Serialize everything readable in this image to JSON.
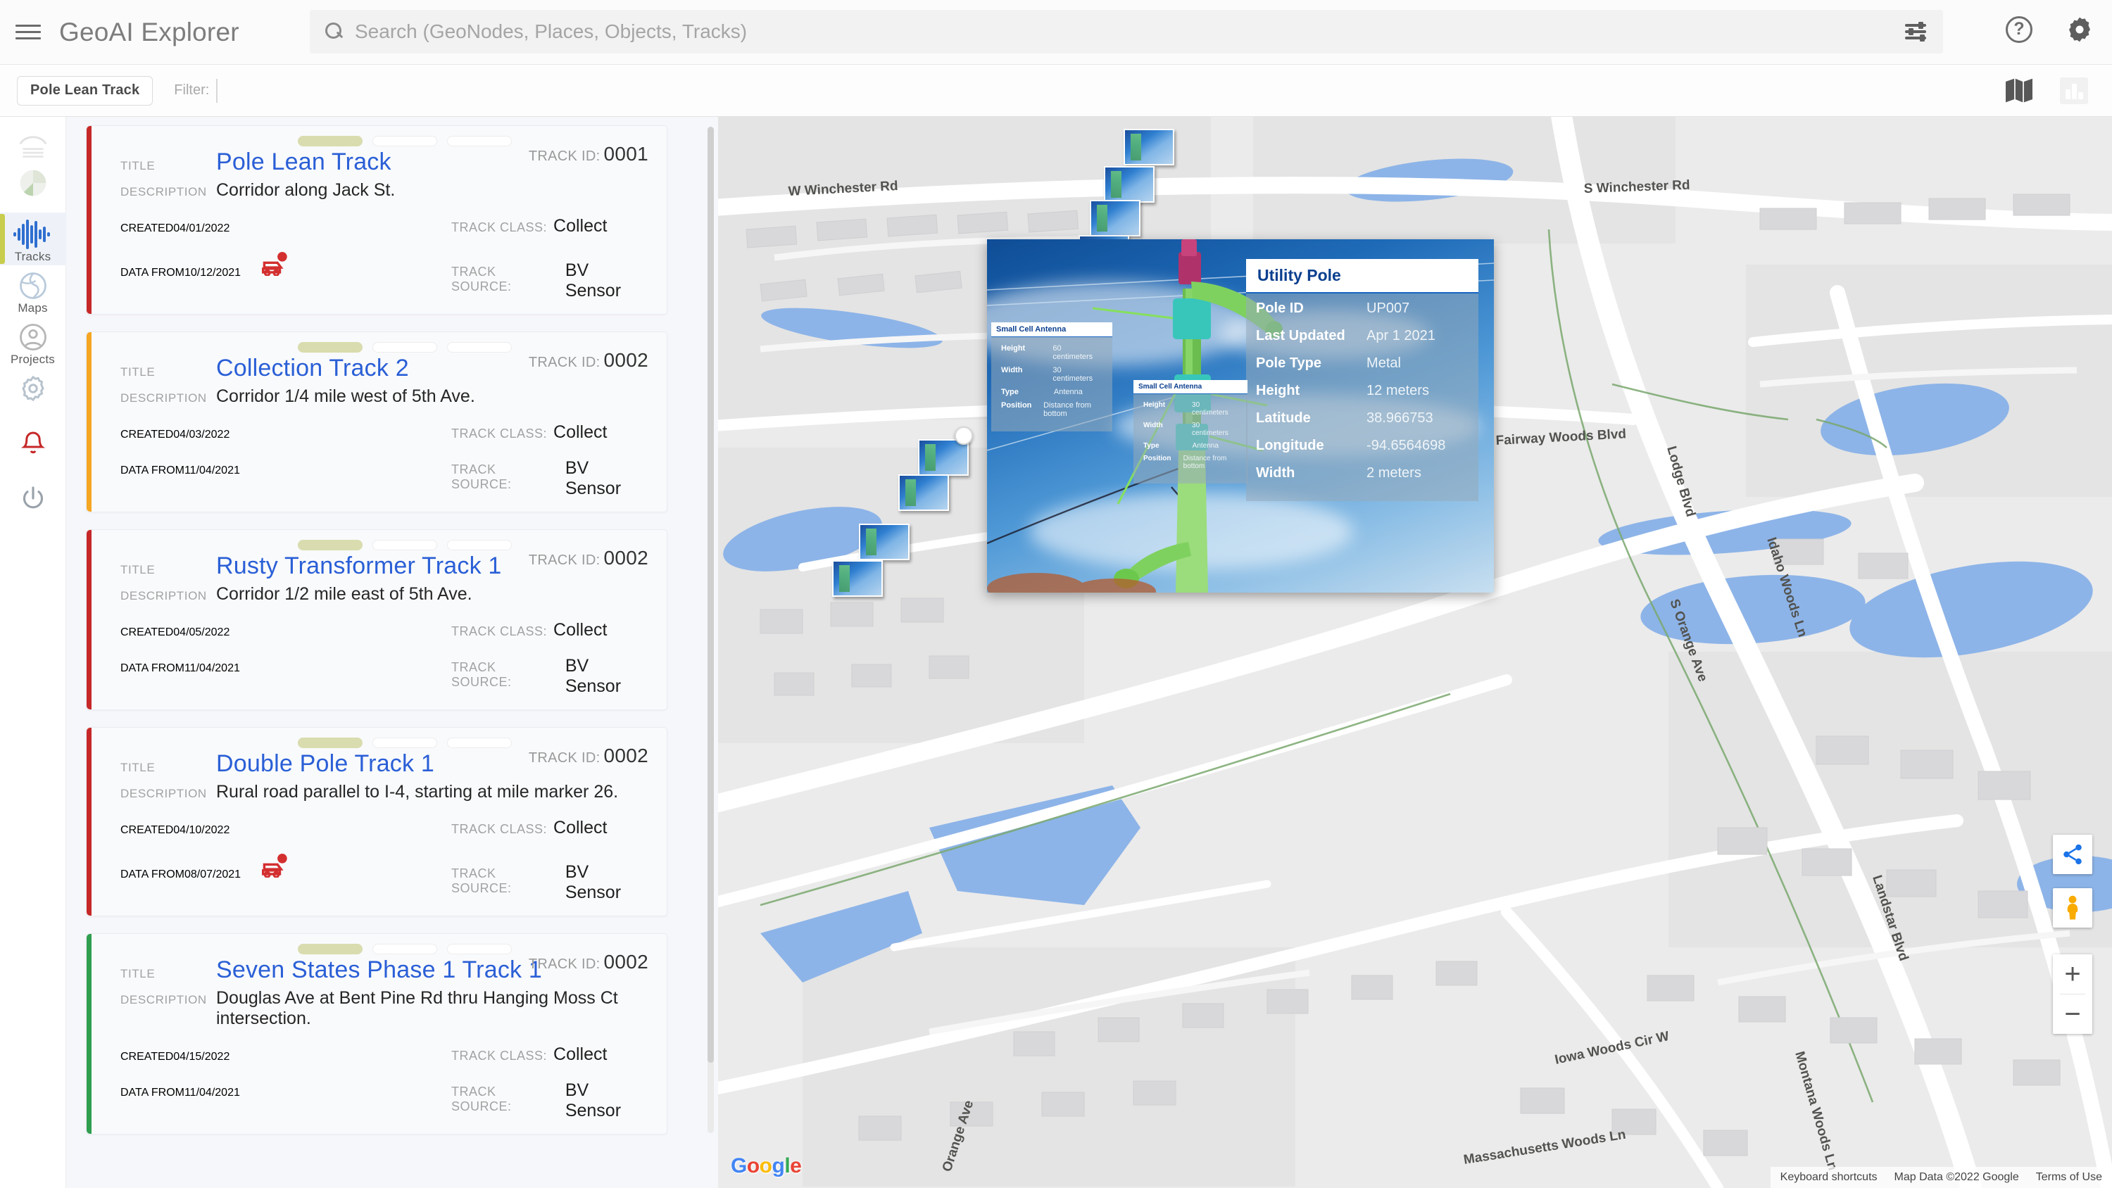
{
  "app": {
    "title": "GeoAI Explorer",
    "menu_icon": "hamburger-icon"
  },
  "search": {
    "placeholder": "Search (GeoNodes, Places, Objects, Tracks)",
    "value": "",
    "tune_icon": "tune-icon"
  },
  "header_actions": {
    "help": "help-icon",
    "settings": "gear-icon"
  },
  "filter_bar": {
    "chip": "Pole Lean Track",
    "filter_label": "Filter:",
    "map_view": "map-icon",
    "chart_view": "chart-icon"
  },
  "sidebar": {
    "items": [
      {
        "id": "analytics",
        "icon": "analytics-icon",
        "label": "",
        "active": false
      },
      {
        "id": "pie",
        "icon": "pie-chart-icon",
        "label": "",
        "active": false
      },
      {
        "id": "tracks",
        "icon": "waveform-icon",
        "label": "Tracks",
        "active": true
      },
      {
        "id": "maps",
        "icon": "globe-icon",
        "label": "Maps",
        "active": false
      },
      {
        "id": "projects",
        "icon": "person-circle-icon",
        "label": "Projects",
        "active": false
      },
      {
        "id": "settings",
        "icon": "gear-icon",
        "label": "",
        "active": false
      },
      {
        "id": "alerts",
        "icon": "bell-icon",
        "label": "",
        "active": false
      },
      {
        "id": "power",
        "icon": "power-icon",
        "label": "",
        "active": false
      }
    ],
    "active_accent": "#c8cd4d",
    "alert_color": "#d32f2f"
  },
  "track_list": {
    "labels": {
      "title": "TITLE",
      "description": "DESCRIPTION",
      "created": "CREATED",
      "data_from": "DATA FROM",
      "track_id": "TRACK ID:",
      "track_class": "TRACK CLASS:",
      "track_source": "TRACK SOURCE:"
    },
    "cards": [
      {
        "accent": "#c62828",
        "track_id": "0001",
        "title": "Pole Lean Track",
        "description": "Corridor along Jack St.",
        "created": "04/01/2022",
        "data_from": "10/12/2021",
        "track_class": "Collect",
        "track_source": "BV Sensor",
        "alert": true,
        "pills": [
          true,
          false,
          false
        ]
      },
      {
        "accent": "#f5a623",
        "track_id": "0002",
        "title": "Collection Track 2",
        "description": "Corridor 1/4 mile west of 5th Ave.",
        "created": "04/03/2022",
        "data_from": "11/04/2021",
        "track_class": "Collect",
        "track_source": "BV Sensor",
        "alert": false,
        "pills": [
          true,
          false,
          false
        ]
      },
      {
        "accent": "#c62828",
        "track_id": "0002",
        "title": "Rusty Transformer Track 1",
        "description": "Corridor 1/2 mile east of 5th Ave.",
        "created": "04/05/2022",
        "data_from": "11/04/2021",
        "track_class": "Collect",
        "track_source": "BV Sensor",
        "alert": false,
        "pills": [
          true,
          false,
          false
        ]
      },
      {
        "accent": "#c62828",
        "track_id": "0002",
        "title": "Double Pole Track 1",
        "description": "Rural road parallel to I-4, starting at mile marker 26.",
        "created": "04/10/2022",
        "data_from": "08/07/2021",
        "track_class": "Collect",
        "track_source": "BV Sensor",
        "alert": true,
        "pills": [
          true,
          false,
          false
        ]
      },
      {
        "accent": "#2e9e4f",
        "track_id": "0002",
        "title": "Seven States Phase 1 Track 1",
        "description": "Douglas Ave at Bent Pine Rd thru Hanging Moss Ct intersection.",
        "created": "04/15/2022",
        "data_from": "11/04/2021",
        "track_class": "Collect",
        "track_source": "BV Sensor",
        "alert": false,
        "pills": [
          true,
          false,
          false
        ]
      }
    ]
  },
  "map": {
    "street_labels": [
      "W Winchester Rd",
      "S Winchester Rd",
      "Fairway Woods Blvd",
      "Lodge Blvd",
      "Idaho Woods Ln",
      "Landstar Blvd",
      "Iowa Woods Cir W",
      "Montana Woods Ln",
      "Massachusetts Woods Ln",
      "S Orange Ave",
      "Orange Ave"
    ],
    "google_logo": "Google",
    "attribution": {
      "keyboard": "Keyboard shortcuts",
      "data": "Map Data ©2022 Google",
      "terms": "Terms of Use"
    },
    "controls": {
      "fullscreen": "share-network-icon",
      "pegman": "street-view-pegman-icon",
      "zoom_in": "+",
      "zoom_out": "−"
    }
  },
  "popup": {
    "main_panel": {
      "title": "Utility Pole",
      "rows": [
        {
          "key": "Pole ID",
          "value": "UP007"
        },
        {
          "key": "Last Updated",
          "value": "Apr 1 2021"
        },
        {
          "key": "Pole Type",
          "value": "Metal"
        },
        {
          "key": "Height",
          "value": "12 meters"
        },
        {
          "key": "Latitude",
          "value": "38.966753"
        },
        {
          "key": "Longitude",
          "value": "-94.6564698"
        },
        {
          "key": "Width",
          "value": "2 meters"
        }
      ]
    },
    "antenna_panel_1": {
      "title": "Small Cell Antenna",
      "rows": [
        {
          "key": "Height",
          "value": "60 centimeters"
        },
        {
          "key": "Width",
          "value": "30 centimeters"
        },
        {
          "key": "Type",
          "value": "Antenna"
        },
        {
          "key": "Position",
          "value": "Distance from bottom"
        }
      ]
    },
    "antenna_panel_2": {
      "title": "Small Cell Antenna",
      "rows": [
        {
          "key": "Height",
          "value": "30 centimeters"
        },
        {
          "key": "Width",
          "value": "30 centimeters"
        },
        {
          "key": "Type",
          "value": "Antenna"
        },
        {
          "key": "Position",
          "value": "Distance from bottom"
        }
      ]
    }
  }
}
